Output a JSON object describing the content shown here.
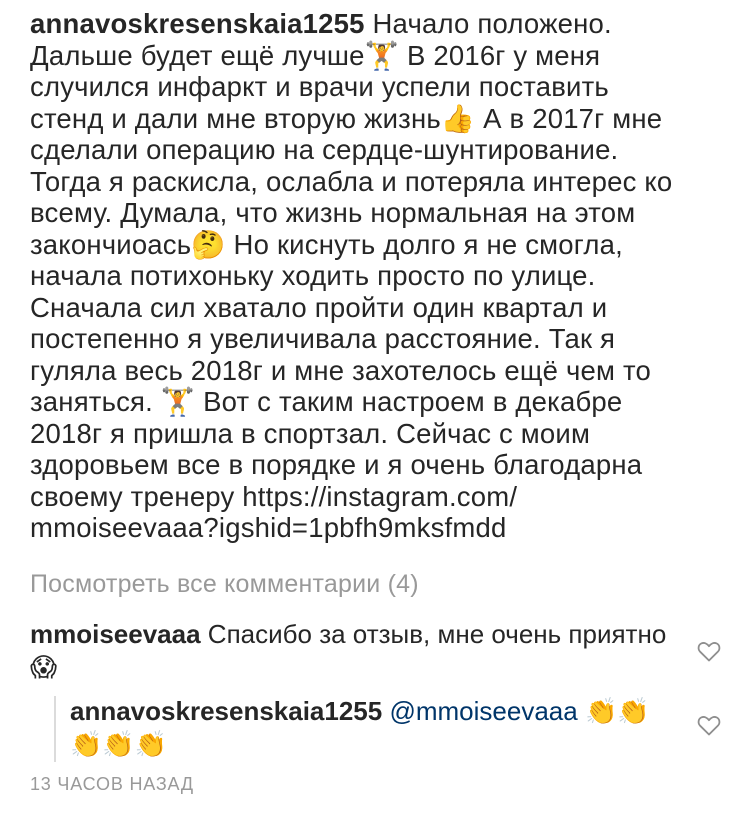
{
  "post": {
    "username": "annavoskresenskaia1255",
    "lines": [
      " Начало положено.",
      "Дальше будет ещё лучше🏋 В 2016г у меня",
      "случился инфаркт и врачи  успели поставить",
      "стенд и дали мне вторую жизнь👍 А в 2017г мне",
      "сделали операцию на сердце-шунтирование.",
      "Тогда я раскисла, ослабла и потеряла интерес ко",
      "всему. Думала, что жизнь нормальная на этом",
      "закончиоась🤔  Но киснуть долго я не смогла,",
      "начала потихоньку ходить просто по улице.",
      "Сначала сил хватало пройти один квартал и",
      "постепенно я увеличивала расстояние. Так я",
      "гуляла весь 2018г и мне захотелось ещё чем то",
      "заняться. 🏋 Вот с таким настроем в декабре",
      "2018г я пришла в спортзал. Сейчас с моим",
      "здоровьем все в порядке и я очень благодарна",
      "своему тренеру https://instagram.com/",
      "mmoiseevaaa?igshid=1pbfh9mksfmdd"
    ]
  },
  "view_all_comments": "Посмотреть все комментарии (4)",
  "comment": {
    "username": "mmoiseevaaa",
    "text": " Спасибо за отзыв, мне очень приятно 😱"
  },
  "reply": {
    "username": "annavoskresenskaia1255",
    "mention": "@mmoiseevaaa",
    "text": " 👏👏👏👏👏"
  },
  "timestamp": "13 ЧАСОВ НАЗАД",
  "icons": {
    "like": "heart-outline-icon"
  }
}
